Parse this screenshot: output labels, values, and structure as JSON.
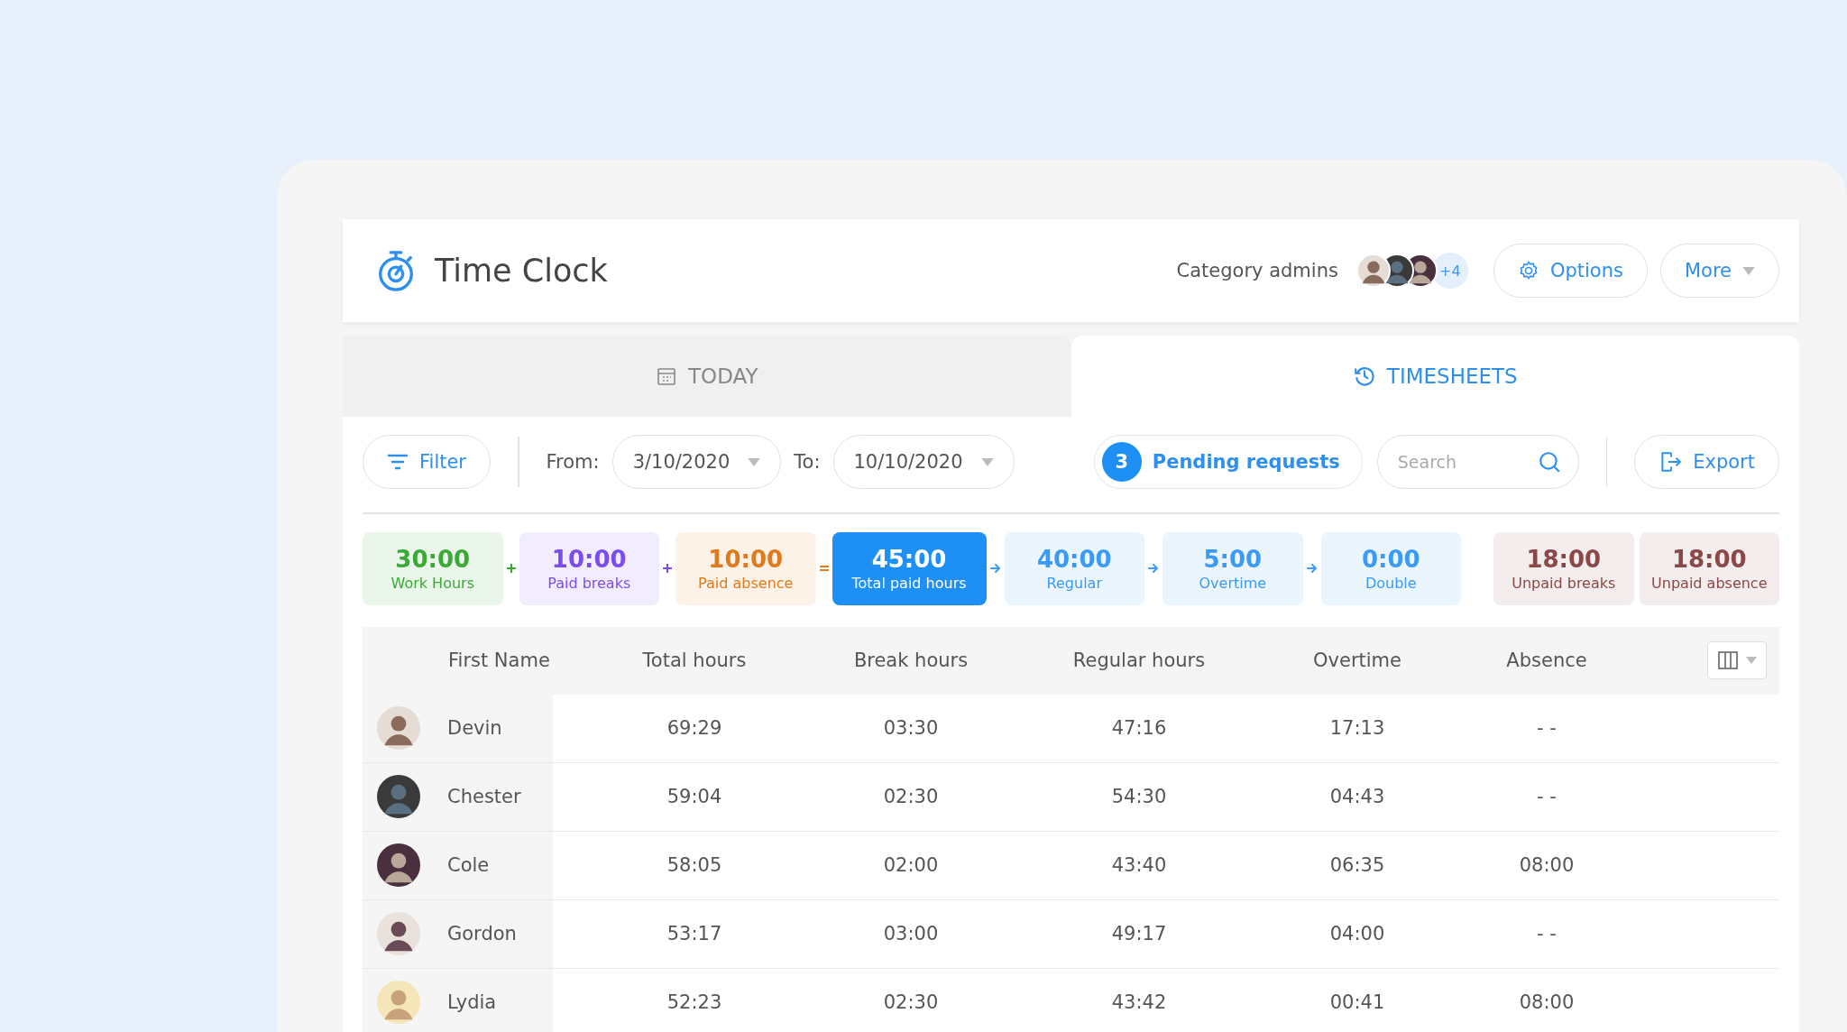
{
  "app": {
    "title": "Time Clock",
    "admins_label": "Category admins",
    "admins_extra": "+4",
    "options_button": "Options",
    "more_button": "More"
  },
  "tabs": [
    {
      "label": "TODAY",
      "selected": false
    },
    {
      "label": "TIMESHEETS",
      "selected": true
    }
  ],
  "toolbar": {
    "filter_button": "Filter",
    "from_label": "From:",
    "from_date": "3/10/2020",
    "to_label": "To:",
    "to_date": "10/10/2020",
    "pending_count": "3",
    "pending_label": "Pending requests",
    "search": {
      "placeholder": "Search"
    },
    "export_button": "Export"
  },
  "stats": [
    {
      "value": "30:00",
      "label": "Work Hours",
      "color": "#3aa935",
      "kind": "tint"
    },
    {
      "value": "10:00",
      "label": "Paid breaks",
      "color": "#7b4cf0",
      "kind": "tint"
    },
    {
      "value": "10:00",
      "label": "Paid absence",
      "color": "#e07a1c",
      "kind": "tint"
    },
    {
      "value": "45:00",
      "label": "Total paid hours",
      "color": "#1e8ff5",
      "kind": "solid"
    },
    {
      "value": "40:00",
      "label": "Regular",
      "color": "#3b9af5",
      "kind": "tint"
    },
    {
      "value": "5:00",
      "label": "Overtime",
      "color": "#3b9af5",
      "kind": "tint"
    },
    {
      "value": "0:00",
      "label": "Double",
      "color": "#3b9af5",
      "kind": "tint"
    }
  ],
  "operators": [
    {
      "kind": "plus"
    },
    {
      "kind": "plus"
    },
    {
      "kind": "equals"
    },
    {
      "kind": "arrow"
    },
    {
      "kind": "arrow"
    },
    {
      "kind": "arrow"
    }
  ],
  "unpaid_stats": [
    {
      "value": "18:00",
      "label": "Unpaid breaks",
      "color": "#8a4848",
      "kind": "tint"
    },
    {
      "value": "18:00",
      "label": "Unpaid absence",
      "color": "#8a4848",
      "kind": "tint"
    }
  ],
  "table": {
    "columns": [
      "First Name",
      "Total hours",
      "Break hours",
      "Regular hours",
      "Overtime",
      "Absence"
    ],
    "rows": [
      {
        "cells": [
          "Devin",
          "69:29",
          "03:30",
          "47:16",
          "17:13",
          "- -"
        ]
      },
      {
        "cells": [
          "Chester",
          "59:04",
          "02:30",
          "54:30",
          "04:43",
          "- -"
        ]
      },
      {
        "cells": [
          "Cole",
          "58:05",
          "02:00",
          "43:40",
          "06:35",
          "08:00"
        ]
      },
      {
        "cells": [
          "Gordon",
          "53:17",
          "03:00",
          "49:17",
          "04:00",
          "- -"
        ]
      },
      {
        "cells": [
          "Lydia",
          "52:23",
          "02:30",
          "43:42",
          "00:41",
          "08:00"
        ]
      }
    ]
  }
}
